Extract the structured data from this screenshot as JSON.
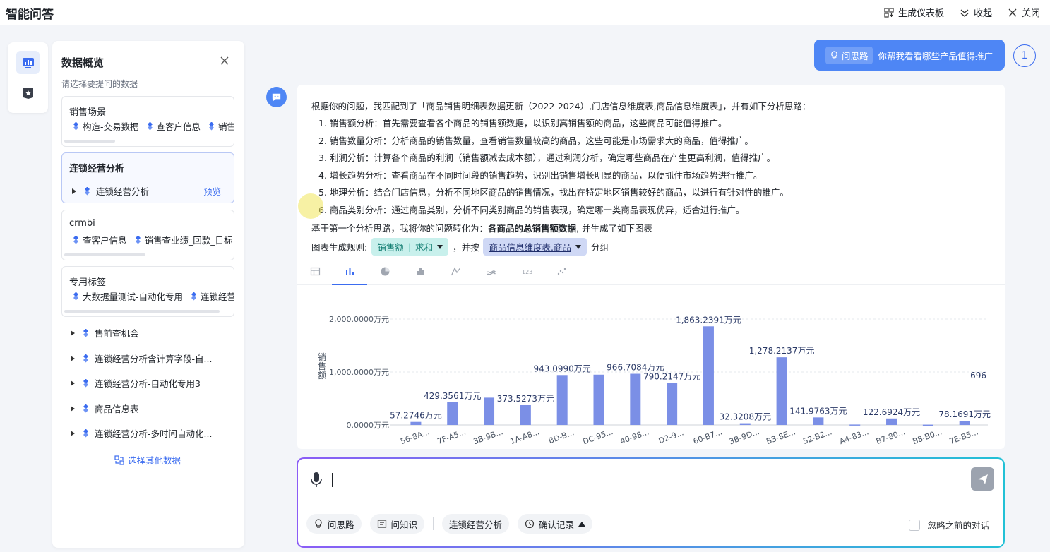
{
  "app": {
    "title": "智能问答"
  },
  "topbar": {
    "generate_dashboard": "生成仪表板",
    "collapse": "收起",
    "close": "关闭"
  },
  "panel": {
    "title": "数据概览",
    "subtitle": "请选择要提问的数据",
    "cards": [
      {
        "title": "销售场景",
        "tags": [
          "构造-交易数据",
          "查客户信息",
          "销售查业绩"
        ]
      },
      {
        "title": "连锁经营分析",
        "item": "连锁经营分析",
        "preview": "预览"
      },
      {
        "title": "crmbi",
        "tags": [
          "查客户信息",
          "销售查业绩_回款_目标"
        ]
      },
      {
        "title": "专用标签",
        "tags": [
          "大数据量测试-自动化专用",
          "连锁经营"
        ]
      }
    ],
    "tree": [
      "售前查机会",
      "连锁经营分析含计算字段-自...",
      "连锁经营分析-自动化专用3",
      "商品信息表",
      "连锁经营分析-多时间自动化..."
    ],
    "select_other": "选择其他数据"
  },
  "user_message": {
    "chip": "问思路",
    "text": "你帮我看看哪些产品值得推广",
    "count": "1"
  },
  "answer": {
    "intro": "根据你的问题，我匹配到了「商品销售明细表数据更新（2022-2024）,门店信息维度表,商品信息维度表」，并有如下分析思路：",
    "items": [
      "1. 销售额分析：首先需要查看各个商品的销售额数据，以识别高销售额的商品，这些商品可能值得推广。",
      "2. 销售数量分析：分析商品的销售数量，查看销售数量较高的商品，这些可能是市场需求大的商品，值得推广。",
      "3. 利润分析：计算各个商品的利润（销售额减去成本额），通过利润分析，确定哪些商品在产生更高利润，值得推广。",
      "4. 增长趋势分析：查看商品在不同时间段的销售趋势，识别出销售增长明显的商品，以便抓住市场趋势进行推广。",
      "5. 地理分析：结合门店信息，分析不同地区商品的销售情况，找出在特定地区销售较好的商品，以进行有针对性的推广。",
      "6. 商品类别分析：通过商品类别，分析不同类别商品的销售表现，确定哪一类商品表现优异，适合进行推广。"
    ],
    "conclusion_pre": "基于第一个分析思路，我将你的问题转化为：",
    "conclusion_bold": "各商品的总销售额数据",
    "conclusion_post": ", 并生成了如下图表",
    "rule_label": "图表生成规则:",
    "measure": "销售额",
    "agg": "求和",
    "mid": "，并按",
    "dimension": "商品信息维度表.商品",
    "group": "分组"
  },
  "chart_data": {
    "type": "bar",
    "ylabel": "销售额",
    "ylim": [
      0,
      2000
    ],
    "y_ticks": [
      "2,000.0000万元",
      "1,000.0000万元",
      "0.0000万元"
    ],
    "bar_color": "#7b8fe6",
    "categories": [
      "56-8A...",
      "7F-A5...",
      "3B-9B...",
      "1A-A8...",
      "BD-B...",
      "DC-95...",
      "40-98...",
      "D2-9...",
      "60-B7...",
      "3B-9D...",
      "B3-8E...",
      "52-B2...",
      "A4-83...",
      "B7-80...",
      "B8-B0...",
      "7E-B5..."
    ],
    "values": [
      57.2746,
      429.3561,
      515,
      373.5273,
      943.099,
      950,
      966.7084,
      790.2147,
      1863.2391,
      32.3208,
      1278.2137,
      141.9763,
      8,
      122.6924,
      6,
      78.1691
    ],
    "labels": [
      "57.2746万元",
      "429.3561万元",
      "",
      "373.5273万元",
      "943.0990万元",
      "",
      "966.7084万元",
      "790.2147万元",
      "1,863.2391万元",
      "32.3208万元",
      "1,278.2137万元",
      "141.9763万元",
      "",
      "122.6924万元",
      "",
      "78.1691万元"
    ],
    "partial_label": "696"
  },
  "composer": {
    "chip_idea": "问思路",
    "chip_knowledge": "问知识",
    "chip_dataset": "连锁经营分析",
    "chip_confirm": "确认记录",
    "ignore": "忽略之前的对话"
  }
}
